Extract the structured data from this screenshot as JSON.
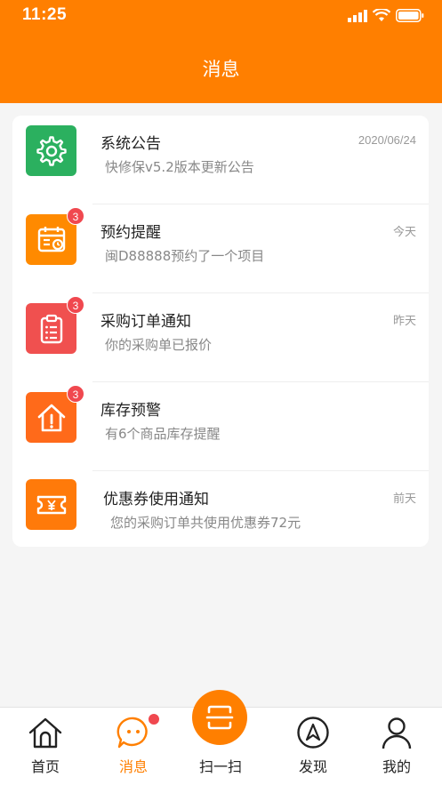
{
  "status_bar": {
    "time": "11:25"
  },
  "header": {
    "title": "消息"
  },
  "messages": [
    {
      "title": "系统公告",
      "subtitle": "快修保v5.2版本更新公告",
      "time": "2020/06/24",
      "badge": "",
      "icon": "gear-icon",
      "color": "#2bb05f"
    },
    {
      "title": "预约提醒",
      "subtitle": "闽D88888预约了一个项目",
      "time": "今天",
      "badge": "3",
      "icon": "calendar-icon",
      "color": "#ff8a00"
    },
    {
      "title": "采购订单通知",
      "subtitle": "你的采购单已报价",
      "time": "昨天",
      "badge": "3",
      "icon": "clipboard-icon",
      "color": "#f0504f"
    },
    {
      "title": "库存预警",
      "subtitle": "有6个商品库存提醒",
      "time": "",
      "badge": "3",
      "icon": "house-alert-icon",
      "color": "#ff6a1a"
    },
    {
      "title": "优惠券使用通知",
      "subtitle": "您的采购订单共使用优惠券72元",
      "time": "前天",
      "badge": "",
      "icon": "coupon-icon",
      "color": "#ff7a0a"
    }
  ],
  "tabbar": {
    "items": [
      {
        "label": "首页",
        "icon": "home-icon"
      },
      {
        "label": "消息",
        "icon": "chat-icon"
      },
      {
        "label": "扫一扫",
        "icon": "scan-icon"
      },
      {
        "label": "发现",
        "icon": "compass-icon"
      },
      {
        "label": "我的",
        "icon": "user-icon"
      }
    ],
    "active_color": "#ff7f00"
  }
}
